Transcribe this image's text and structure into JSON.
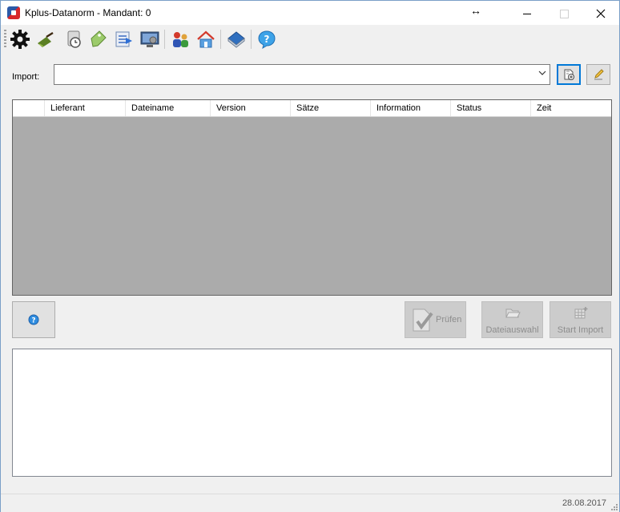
{
  "window": {
    "title": "Kplus-Datanorm - Mandant: 0",
    "resize_hint": "↔"
  },
  "toolbar": {
    "icons": [
      "gear-icon",
      "shovel-icon",
      "clock-icon",
      "price-tag-icon",
      "export-list-icon",
      "monitor-icon",
      "people-icon",
      "house-icon",
      "book-icon",
      "help-icon"
    ]
  },
  "import": {
    "label": "Import:",
    "value": ""
  },
  "grid": {
    "columns": [
      "",
      "Lieferant",
      "Dateiname",
      "Version",
      "Sätze",
      "Information",
      "Status",
      "Zeit"
    ],
    "rows": []
  },
  "buttons": {
    "pruefen": "Prüfen",
    "dateiauswahl": "Dateiauswahl",
    "start_import": "Start Import"
  },
  "log": {
    "text": ""
  },
  "status": {
    "date": "28.08.2017"
  },
  "colors": {
    "grid_background": "#ababab",
    "accent": "#0078d7"
  }
}
